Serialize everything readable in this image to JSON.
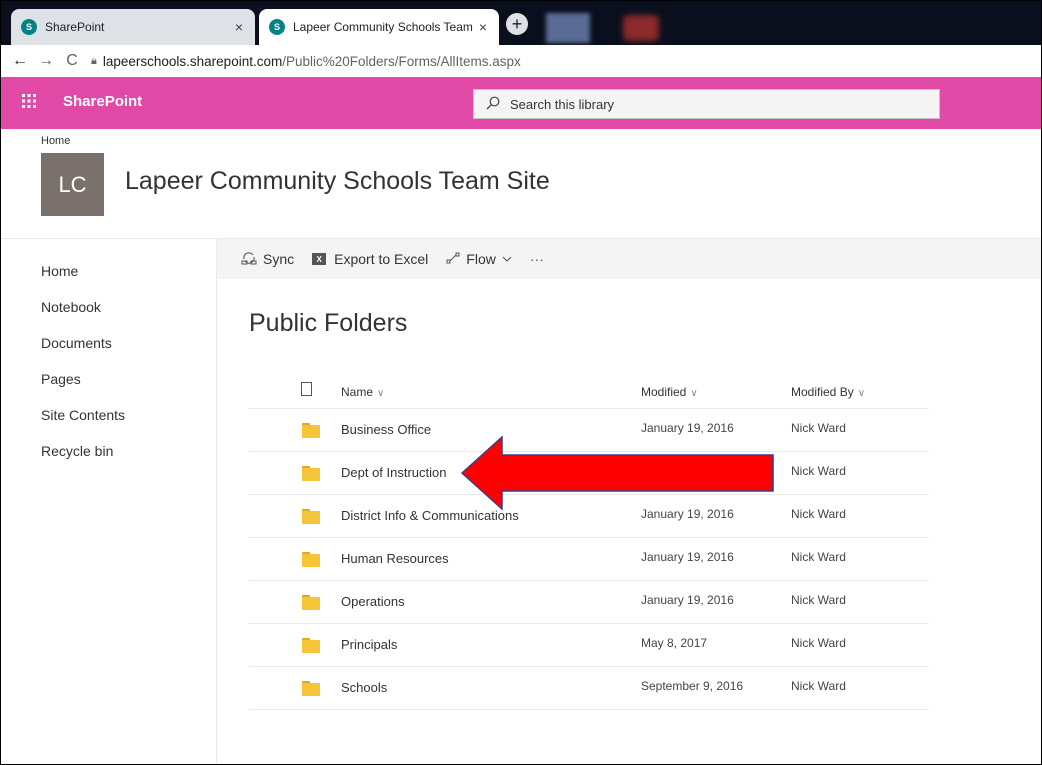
{
  "browser": {
    "tabs": [
      {
        "favicon": "S",
        "title": "SharePoint",
        "close": "×"
      },
      {
        "favicon": "S",
        "title": "Lapeer Community Schools Team",
        "close": "×"
      }
    ],
    "new_tab": "+",
    "nav": {
      "back": "←",
      "forward": "→",
      "reload": "C"
    },
    "url": {
      "host": "lapeerschools.sharepoint.com",
      "path": "/Public%20Folders/Forms/AllItems.aspx"
    }
  },
  "suitebar": {
    "app_name": "SharePoint",
    "search_placeholder": "Search this library",
    "color": "#e149a6"
  },
  "site": {
    "breadcrumb": "Home",
    "logo_text": "LC",
    "title": "Lapeer Community Schools Team Site"
  },
  "leftnav": {
    "items": [
      "Home",
      "Notebook",
      "Documents",
      "Pages",
      "Site Contents",
      "Recycle bin"
    ]
  },
  "commands": {
    "sync": "Sync",
    "export": "Export to Excel",
    "excel_icon": "X",
    "flow": "Flow",
    "more": "···"
  },
  "library": {
    "title": "Public Folders",
    "columns": {
      "name": "Name",
      "modified": "Modified",
      "modified_by": "Modified By"
    },
    "rows": [
      {
        "name": "Business Office",
        "modified": "January 19, 2016",
        "modified_by": "Nick Ward"
      },
      {
        "name": "Dept of Instruction",
        "modified": "",
        "modified_by": "Nick Ward"
      },
      {
        "name": "District Info & Communications",
        "modified": "January 19, 2016",
        "modified_by": "Nick Ward"
      },
      {
        "name": "Human Resources",
        "modified": "January 19, 2016",
        "modified_by": "Nick Ward"
      },
      {
        "name": "Operations",
        "modified": "January 19, 2016",
        "modified_by": "Nick Ward"
      },
      {
        "name": "Principals",
        "modified": "May 8, 2017",
        "modified_by": "Nick Ward"
      },
      {
        "name": "Schools",
        "modified": "September 9, 2016",
        "modified_by": "Nick Ward"
      }
    ]
  },
  "annotation": {
    "arrow_color": "#ff0000",
    "points_to": "Dept of Instruction"
  }
}
